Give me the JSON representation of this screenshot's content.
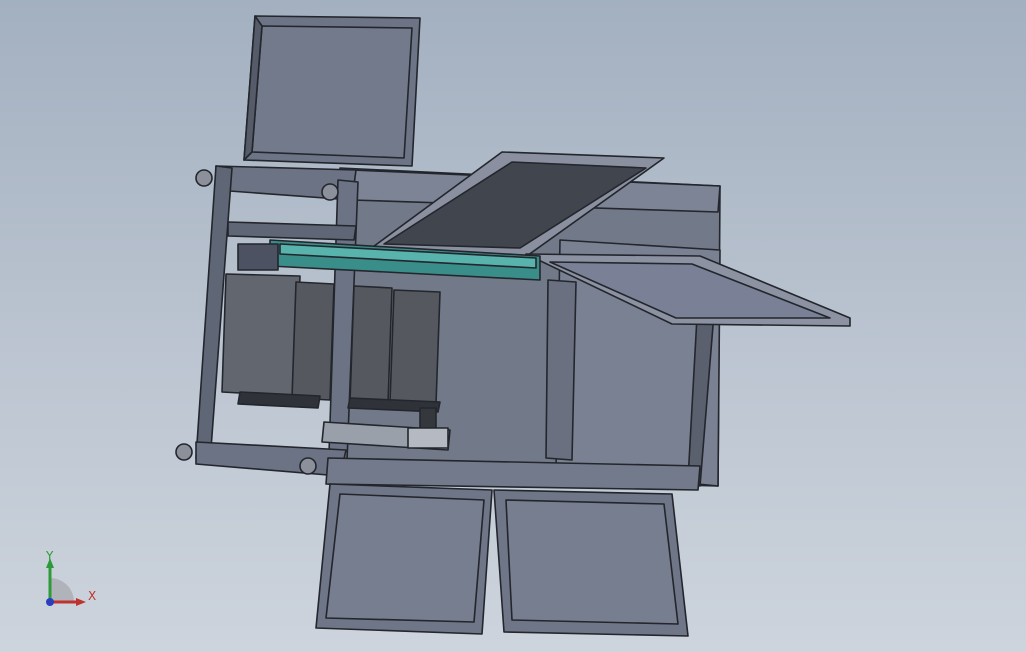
{
  "viewport": {
    "background_top": "#a3b0c0",
    "background_bottom": "#cdd4dd"
  },
  "colors": {
    "frame_edge": "#23262c",
    "frame_face": "#6c7384",
    "frame_dark": "#4c5262",
    "panel_light": "#767d8c",
    "panel_dark": "#3f434c",
    "lid_face": "#7a8193",
    "conveyor_teal": "#3a8e8a",
    "x_axis": "#c0322f",
    "y_axis": "#2d9a3a",
    "z_axis": "#2a3fbf"
  },
  "triad": {
    "x_label": "X",
    "y_label": "Y",
    "icon": "coordinate-triad-icon"
  }
}
